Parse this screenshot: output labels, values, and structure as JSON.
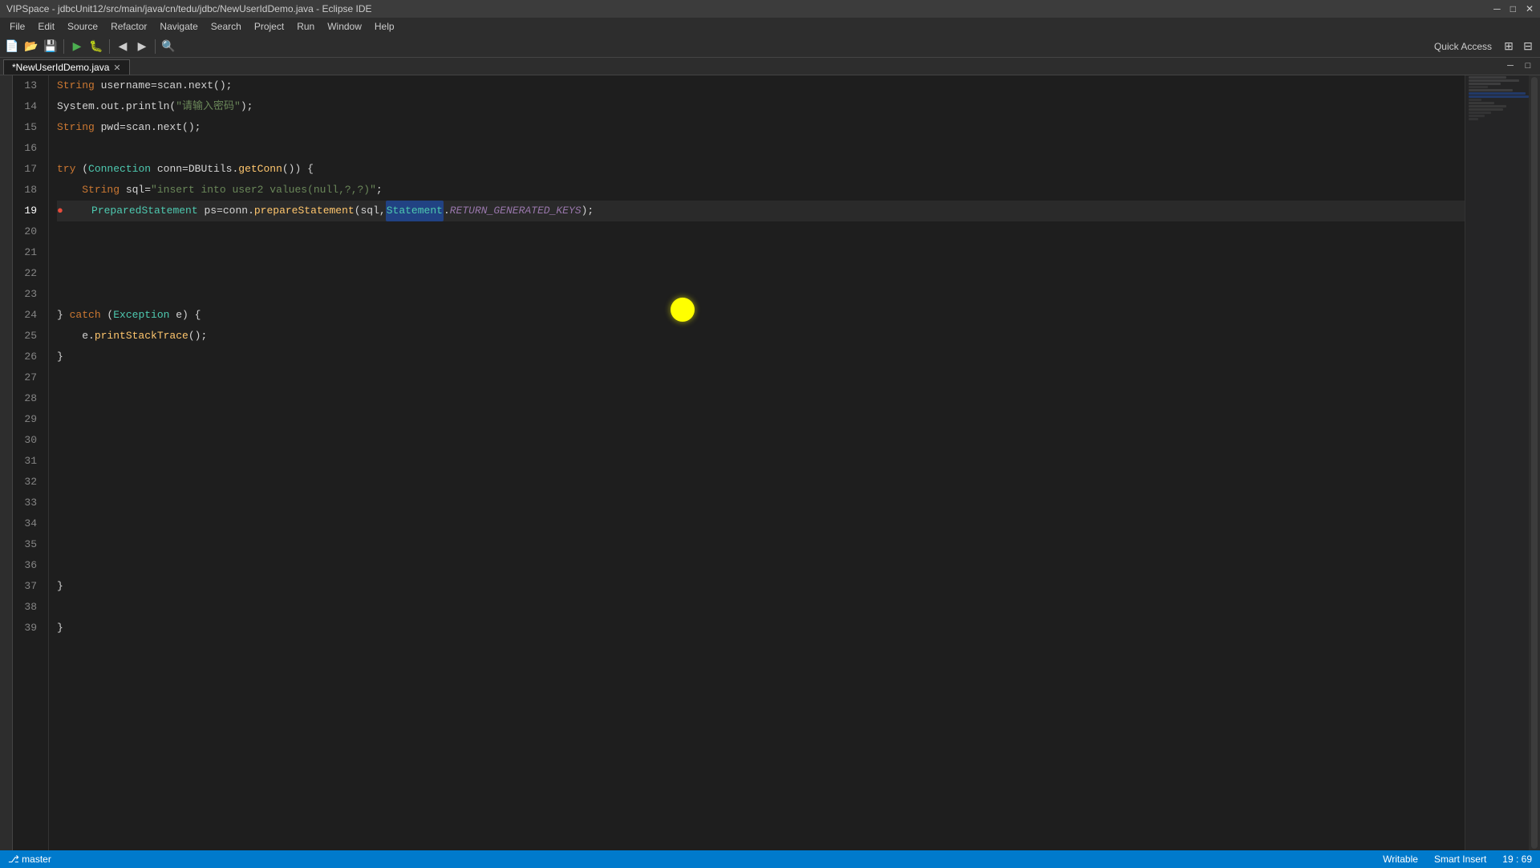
{
  "titleBar": {
    "text": "VIPSpace - jdbcUnit12/src/main/java/cn/tedu/jdbc/NewUserIdDemo.java - Eclipse IDE"
  },
  "menuBar": {
    "items": [
      "File",
      "Edit",
      "Source",
      "Refactor",
      "Navigate",
      "Search",
      "Project",
      "Run",
      "Window",
      "Help"
    ]
  },
  "toolbar": {
    "quickAccess": "Quick Access"
  },
  "tabs": [
    {
      "label": "*NewUserIdDemo.java",
      "active": true,
      "closeable": true
    }
  ],
  "statusBar": {
    "writable": "Writable",
    "smartInsert": "Smart Insert",
    "position": "19 : 69"
  },
  "lines": [
    {
      "num": 13,
      "content": ""
    },
    {
      "num": 14,
      "content": ""
    },
    {
      "num": 15,
      "content": ""
    },
    {
      "num": 16,
      "content": ""
    },
    {
      "num": 17,
      "content": ""
    },
    {
      "num": 18,
      "content": ""
    },
    {
      "num": 19,
      "content": "",
      "current": true,
      "error": true
    },
    {
      "num": 20,
      "content": ""
    },
    {
      "num": 21,
      "content": ""
    },
    {
      "num": 22,
      "content": ""
    },
    {
      "num": 23,
      "content": ""
    },
    {
      "num": 24,
      "content": ""
    },
    {
      "num": 25,
      "content": ""
    },
    {
      "num": 26,
      "content": ""
    },
    {
      "num": 27,
      "content": ""
    },
    {
      "num": 28,
      "content": ""
    },
    {
      "num": 29,
      "content": ""
    },
    {
      "num": 30,
      "content": ""
    },
    {
      "num": 31,
      "content": ""
    },
    {
      "num": 32,
      "content": ""
    },
    {
      "num": 33,
      "content": ""
    },
    {
      "num": 34,
      "content": ""
    },
    {
      "num": 35,
      "content": ""
    },
    {
      "num": 36,
      "content": ""
    },
    {
      "num": 37,
      "content": ""
    },
    {
      "num": 38,
      "content": ""
    },
    {
      "num": 39,
      "content": ""
    }
  ]
}
